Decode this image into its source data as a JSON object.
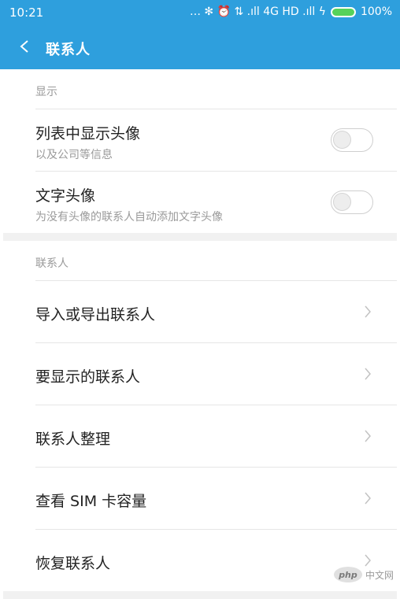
{
  "status_bar": {
    "time": "10:21",
    "indicators": "… ✻ ⏰ ⇅ .ıll 4G HD .ıll ϟ",
    "battery": "100%",
    "icons": [
      "more-icon",
      "bluetooth-icon",
      "alarm-icon",
      "data-icon",
      "signal-icon",
      "charging-icon",
      "battery-icon"
    ]
  },
  "app_bar": {
    "title": "联系人",
    "back_icon": "back-chevron-icon",
    "color": "#2e9fdd"
  },
  "sections": {
    "display": {
      "header": "显示",
      "rows": [
        {
          "title": "列表中显示头像",
          "subtitle": "以及公司等信息",
          "enabled": false
        },
        {
          "title": "文字头像",
          "subtitle": "为没有头像的联系人自动添加文字头像",
          "enabled": false
        }
      ]
    },
    "contacts": {
      "header": "联系人",
      "rows": [
        {
          "title": "导入或导出联系人"
        },
        {
          "title": "要显示的联系人"
        },
        {
          "title": "联系人整理"
        },
        {
          "title": "查看 SIM 卡容量"
        },
        {
          "title": "恢复联系人"
        }
      ]
    }
  },
  "watermark": {
    "logo": "php",
    "label": "中文网"
  }
}
